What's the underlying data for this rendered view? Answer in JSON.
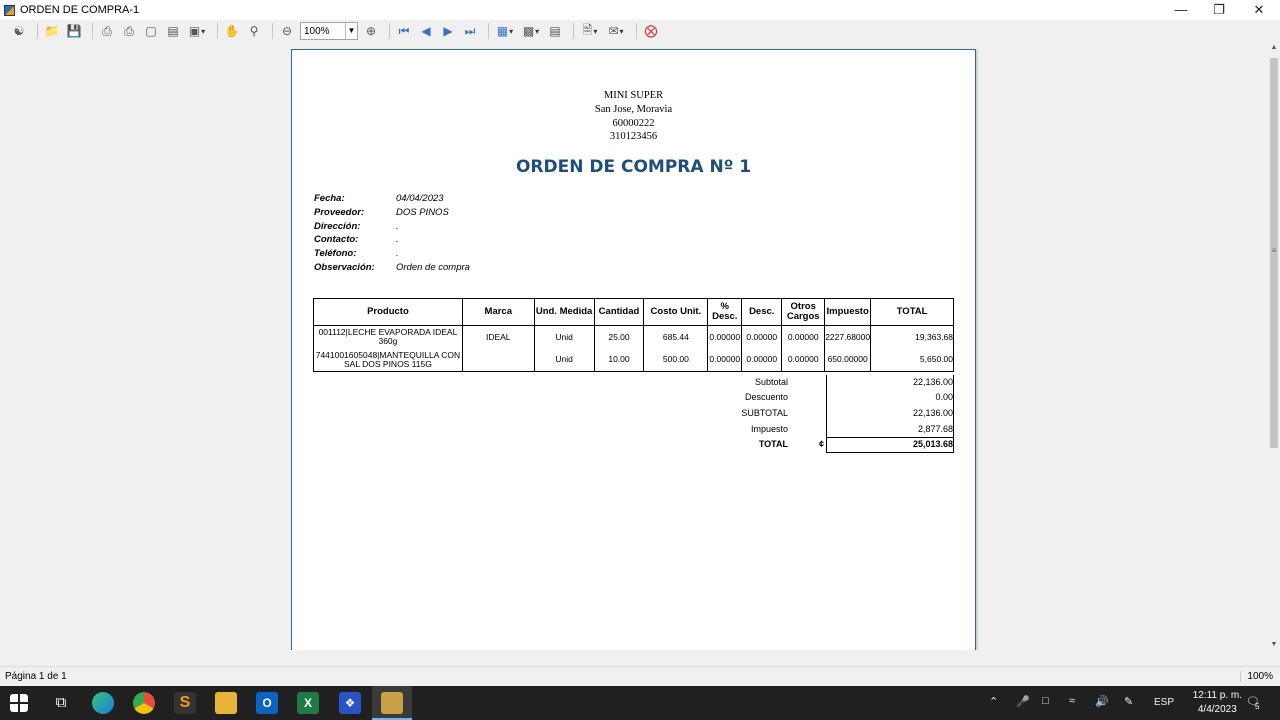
{
  "window": {
    "title": "ORDEN DE COMPRA-1"
  },
  "toolbar": {
    "zoom_value": "100%"
  },
  "report": {
    "company": [
      "MINI SUPER",
      "San Jose, Moravia",
      "60000222",
      "310123456"
    ],
    "title": "ORDEN DE COMPRA Nº 1",
    "fields": [
      {
        "label": "Fecha:",
        "value": "04/04/2023"
      },
      {
        "label": "Proveedor:",
        "value": "DOS PINOS"
      },
      {
        "label": "Dirección:",
        "value": "."
      },
      {
        "label": "Contacto:",
        "value": "."
      },
      {
        "label": "Teléfono:",
        "value": "."
      },
      {
        "label": "Observación:",
        "value": "Orden de compra"
      }
    ],
    "columns": [
      "Producto",
      "Marca",
      "Und. Medida",
      "Cantidad",
      "Costo Unit.",
      "% Desc.",
      "Desc.",
      "Otros Cargos",
      "Impuesto",
      "TOTAL"
    ],
    "rows": [
      [
        "001112|LECHE EVAPORADA IDEAL 360g",
        "IDEAL",
        "Unid",
        "25.00",
        "685.44",
        "0.00000",
        "0.00000",
        "0.00000",
        "2227.68000",
        "19,363.68"
      ],
      [
        "7441001605048|MANTEQUILLA CON SAL DOS PINOS 115G",
        "",
        "Unid",
        "10.00",
        "500.00",
        "0.00000",
        "0.00000",
        "0.00000",
        "650.00000",
        "5,650.00"
      ]
    ],
    "totals": [
      {
        "label": "Subtotal",
        "value": "22,136.00"
      },
      {
        "label": "Descuento",
        "value": "0.00"
      },
      {
        "label": "SUBTOTAL",
        "value": "22,136.00"
      },
      {
        "label": "Impuesto",
        "value": "2,877.68"
      },
      {
        "label": "TOTAL",
        "value": "25,013.68"
      }
    ],
    "currency_symbol": "¢"
  },
  "status": {
    "page_info": "Página 1 de 1",
    "zoom": "100%"
  },
  "taskbar": {
    "lang": "ESP",
    "time": "12:11 p. m.",
    "date": "4/4/2023",
    "notification_count": "5"
  }
}
